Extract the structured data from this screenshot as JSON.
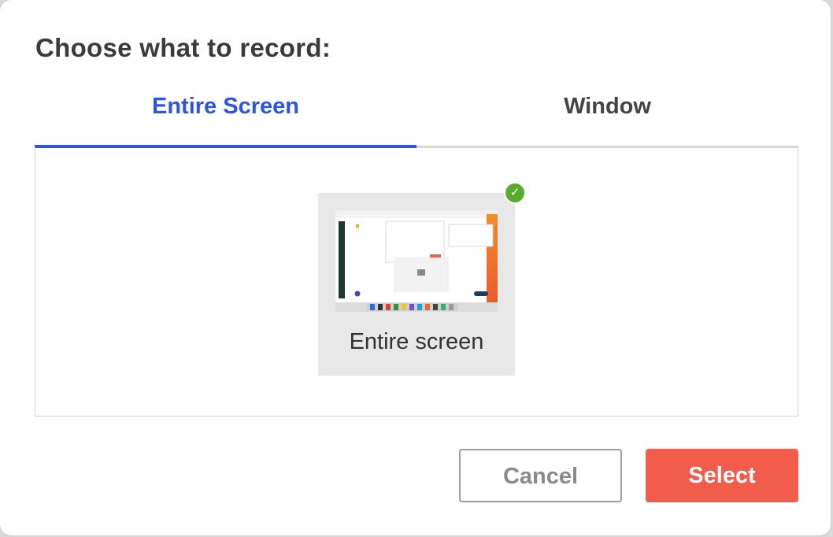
{
  "dialog": {
    "title": "Choose what to record:"
  },
  "tabs": [
    {
      "label": "Entire Screen",
      "active": true
    },
    {
      "label": "Window",
      "active": false
    }
  ],
  "sources": [
    {
      "label": "Entire screen",
      "selected": true,
      "check_icon": "checkmark-icon"
    }
  ],
  "buttons": {
    "cancel_label": "Cancel",
    "select_label": "Select"
  },
  "colors": {
    "accent": "#2e55e0",
    "primary_button": "#f25d4b",
    "selected_badge": "#5aab2c"
  },
  "check_glyph": "✓"
}
